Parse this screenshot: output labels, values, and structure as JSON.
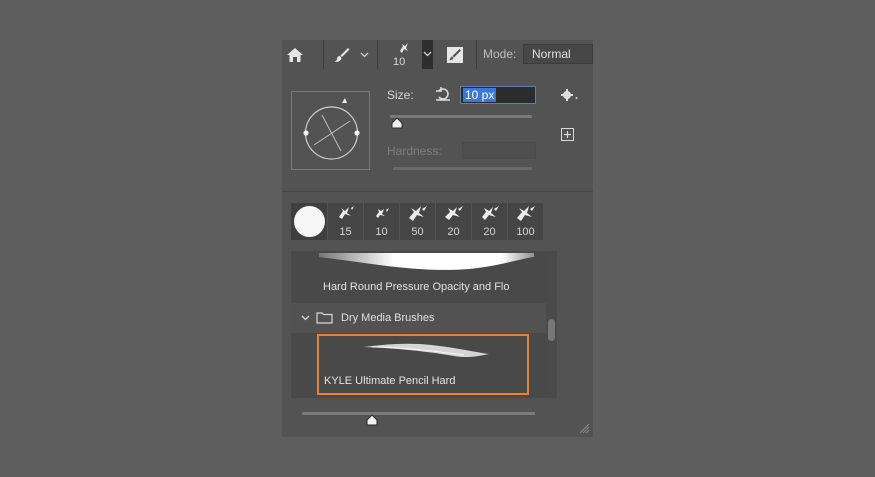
{
  "options_bar": {
    "brush_size_value": "10",
    "mode_label": "Mode:",
    "mode_value": "Normal",
    "icons": [
      "home-icon",
      "brush-tool-icon",
      "chevron-down-icon",
      "brush-preset-icon",
      "chevron-down-icon",
      "brush-settings-icon"
    ]
  },
  "brush_panel": {
    "size_label": "Size:",
    "size_value": "10 px",
    "size_slider_fraction": 0.05,
    "hardness_label": "Hardness:",
    "hardness_value": "",
    "preset_sizes": [
      "15",
      "10",
      "50",
      "20",
      "20",
      "100"
    ],
    "brushes": [
      {
        "name": "Hard Round Pressure Opacity and Flo"
      },
      {
        "name": "KYLE Ultimate Pencil Hard",
        "selected": true
      }
    ],
    "folder": {
      "name": "Dry Media Brushes",
      "expanded": true
    },
    "preview_size_fraction": 0.3,
    "accent_color": "#e8823a",
    "icons": [
      "reset-icon",
      "gear-icon",
      "new-preset-icon",
      "folder-icon",
      "resize-grip-icon"
    ]
  }
}
